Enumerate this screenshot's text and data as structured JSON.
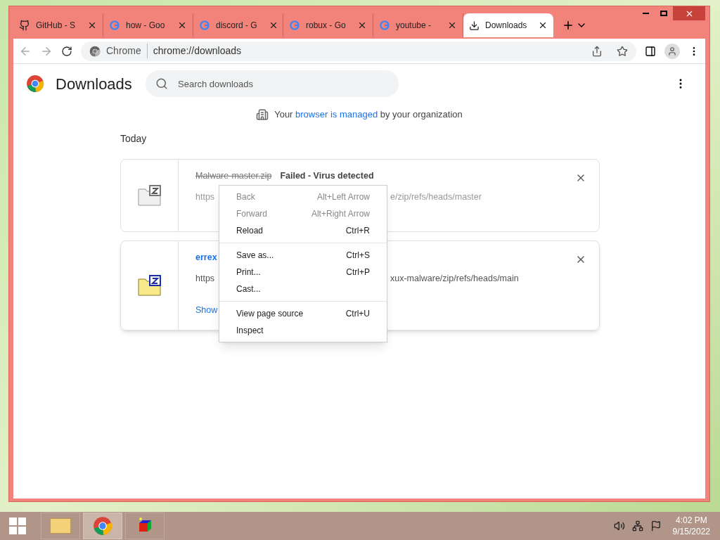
{
  "tabs": [
    {
      "title": "GitHub - S",
      "kind": "github",
      "selected": false
    },
    {
      "title": "how - Goo",
      "kind": "google",
      "selected": false
    },
    {
      "title": "discord - G",
      "kind": "google",
      "selected": false
    },
    {
      "title": "robux - Go",
      "kind": "google",
      "selected": false
    },
    {
      "title": "youtube - ",
      "kind": "google",
      "selected": false
    },
    {
      "title": "Downloads",
      "kind": "download",
      "selected": true
    }
  ],
  "omnibox": {
    "chip": "Chrome",
    "url": "chrome://downloads"
  },
  "page": {
    "title": "Downloads",
    "search_placeholder": "Search downloads",
    "managed": {
      "before": "Your ",
      "link": "browser is managed",
      "after": " by your organization"
    },
    "section": "Today"
  },
  "downloads": [
    {
      "failed": true,
      "name": "Malware-master.zip",
      "status": "Failed - Virus detected",
      "url_left": "https",
      "url_right": "e/zip/refs/heads/master"
    },
    {
      "failed": false,
      "name": "errex",
      "url_left": "https",
      "url_right": "xux-malware/zip/refs/heads/main",
      "action": "Show"
    }
  ],
  "context_menu": [
    [
      {
        "label": "Back",
        "shortcut": "Alt+Left Arrow",
        "disabled": true
      },
      {
        "label": "Forward",
        "shortcut": "Alt+Right Arrow",
        "disabled": true
      },
      {
        "label": "Reload",
        "shortcut": "Ctrl+R",
        "disabled": false
      }
    ],
    [
      {
        "label": "Save as...",
        "shortcut": "Ctrl+S",
        "disabled": false
      },
      {
        "label": "Print...",
        "shortcut": "Ctrl+P",
        "disabled": false
      },
      {
        "label": "Cast...",
        "disabled": false
      }
    ],
    [
      {
        "label": "View page source",
        "shortcut": "Ctrl+U",
        "disabled": false
      },
      {
        "label": "Inspect",
        "disabled": false
      }
    ]
  ],
  "taskbar": {
    "time": "4:02 PM",
    "date": "9/15/2022"
  }
}
